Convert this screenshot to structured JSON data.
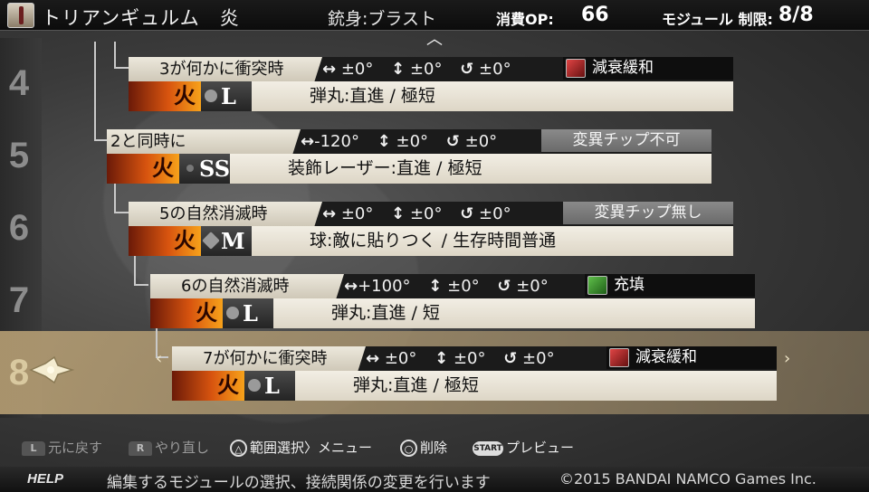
{
  "header": {
    "weapon_name": "トリアンギュルム　炎",
    "barrel": "銃身:ブラスト",
    "op_label": "消費OP:",
    "op_value": "66",
    "limit_label": "モジュール 制限:",
    "limit_value": "8/8"
  },
  "row_numbers": [
    "4",
    "5",
    "6",
    "7",
    "8"
  ],
  "modules": [
    {
      "trigger": "3が何かに衝突時",
      "h": "±0°",
      "v": "±0°",
      "r": "±0°",
      "chip": "減衰緩和",
      "chip_style": "dark",
      "chip_icon": "red",
      "element": "火",
      "size": "L",
      "description": "弾丸:直進 / 極短"
    },
    {
      "trigger": "2と同時に",
      "h": "-120°",
      "v": "±0°",
      "r": "±0°",
      "chip": "変異チップ不可",
      "chip_style": "grey",
      "element": "火",
      "size": "SS",
      "description": "装飾レーザー:直進 / 極短"
    },
    {
      "trigger": "5の自然消滅時",
      "h": "±0°",
      "v": "±0°",
      "r": "±0°",
      "chip": "変異チップ無し",
      "chip_style": "grey",
      "element": "火",
      "size": "M",
      "description": "球:敵に貼りつく / 生存時間普通"
    },
    {
      "trigger": "6の自然消滅時",
      "h": "+100°",
      "v": "±0°",
      "r": "±0°",
      "chip": "充填",
      "chip_style": "dark",
      "chip_icon": "green",
      "element": "火",
      "size": "L",
      "description": "弾丸:直進 / 短"
    },
    {
      "trigger": "7が何かに衝突時",
      "h": "±0°",
      "v": "±0°",
      "r": "±0°",
      "chip": "減衰緩和",
      "chip_style": "dark",
      "chip_icon": "red",
      "element": "火",
      "size": "L",
      "description": "弾丸:直進 / 極短"
    }
  ],
  "symbols": {
    "h": "↔",
    "v": "↕",
    "r": "↺"
  },
  "controls": {
    "undo": "元に戻す",
    "redo": "やり直し",
    "range_menu": "範囲選択〉メニュー",
    "delete": "削除",
    "preview": "プレビュー",
    "l_btn": "L",
    "r_btn": "R",
    "triangle_btn": "△",
    "circle_btn": "○",
    "start_btn": "START"
  },
  "help": {
    "label": "HELP",
    "text": "編集するモジュールの選択、接続関係の変更を行います",
    "copyright": "©2015 BANDAI NAMCO Games Inc."
  },
  "scroll_up": "︿",
  "nav_left": "‹",
  "nav_right": "›",
  "colors": {
    "selected_band": "#bfa578",
    "fire_gradient_end": "#f7a21a",
    "chip_grey": "#7a7a7a"
  }
}
